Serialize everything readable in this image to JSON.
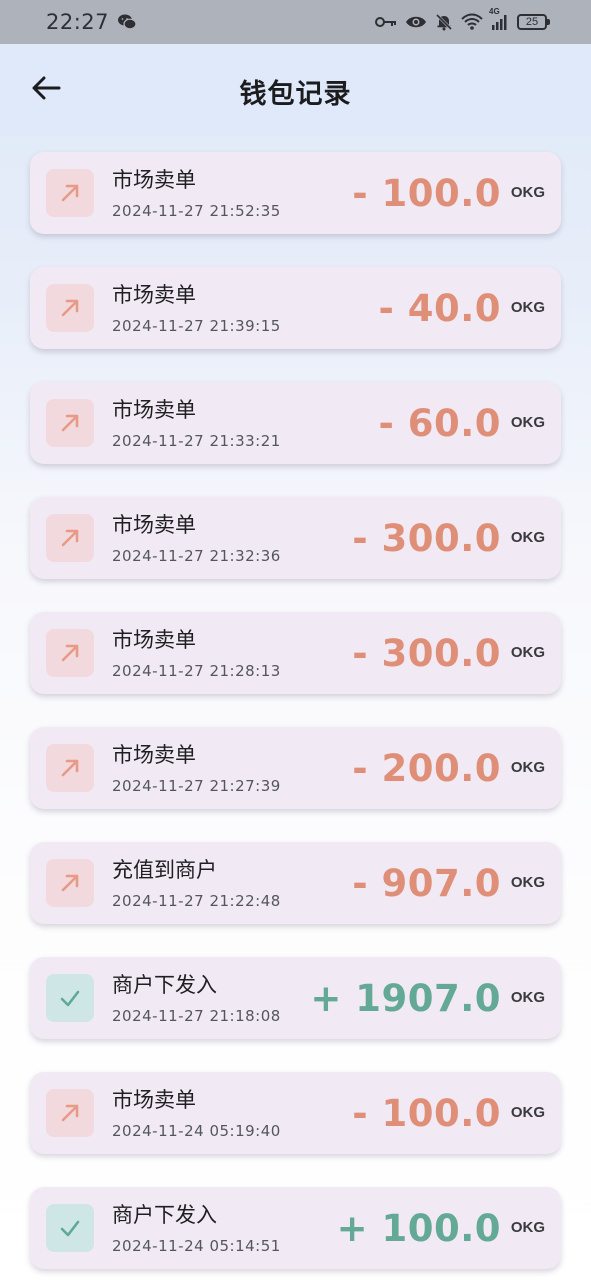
{
  "status_bar": {
    "time": "22:27",
    "battery": "25",
    "signal_label": "4G",
    "icons": [
      "wechat-icon",
      "key-icon",
      "eye-icon",
      "bell-off-icon",
      "wifi-icon",
      "signal-icon",
      "battery-icon"
    ]
  },
  "header": {
    "title": "钱包记录",
    "back_icon": "arrow-left-icon"
  },
  "colors": {
    "outgoing": "#df8f78",
    "incoming": "#64a896",
    "card_bg": "#f1eaf4",
    "header_bg": "#dfe9f9",
    "status_bar_bg": "#aeb3bb"
  },
  "records": [
    {
      "type": "out",
      "icon": "arrow-up-right-icon",
      "title": "市场卖单",
      "time": "2024-11-27 21:52:35",
      "amount": "- 100.0",
      "unit": "OKG"
    },
    {
      "type": "out",
      "icon": "arrow-up-right-icon",
      "title": "市场卖单",
      "time": "2024-11-27 21:39:15",
      "amount": "- 40.0",
      "unit": "OKG"
    },
    {
      "type": "out",
      "icon": "arrow-up-right-icon",
      "title": "市场卖单",
      "time": "2024-11-27 21:33:21",
      "amount": "- 60.0",
      "unit": "OKG"
    },
    {
      "type": "out",
      "icon": "arrow-up-right-icon",
      "title": "市场卖单",
      "time": "2024-11-27 21:32:36",
      "amount": "- 300.0",
      "unit": "OKG"
    },
    {
      "type": "out",
      "icon": "arrow-up-right-icon",
      "title": "市场卖单",
      "time": "2024-11-27 21:28:13",
      "amount": "- 300.0",
      "unit": "OKG"
    },
    {
      "type": "out",
      "icon": "arrow-up-right-icon",
      "title": "市场卖单",
      "time": "2024-11-27 21:27:39",
      "amount": "- 200.0",
      "unit": "OKG"
    },
    {
      "type": "out",
      "icon": "arrow-up-right-icon",
      "title": "充值到商户",
      "time": "2024-11-27 21:22:48",
      "amount": "- 907.0",
      "unit": "OKG"
    },
    {
      "type": "in",
      "icon": "check-icon",
      "title": "商户下发入",
      "time": "2024-11-27 21:18:08",
      "amount": "+ 1907.0",
      "unit": "OKG"
    },
    {
      "type": "out",
      "icon": "arrow-up-right-icon",
      "title": "市场卖单",
      "time": "2024-11-24 05:19:40",
      "amount": "- 100.0",
      "unit": "OKG"
    },
    {
      "type": "in",
      "icon": "check-icon",
      "title": "商户下发入",
      "time": "2024-11-24 05:14:51",
      "amount": "+ 100.0",
      "unit": "OKG"
    }
  ]
}
